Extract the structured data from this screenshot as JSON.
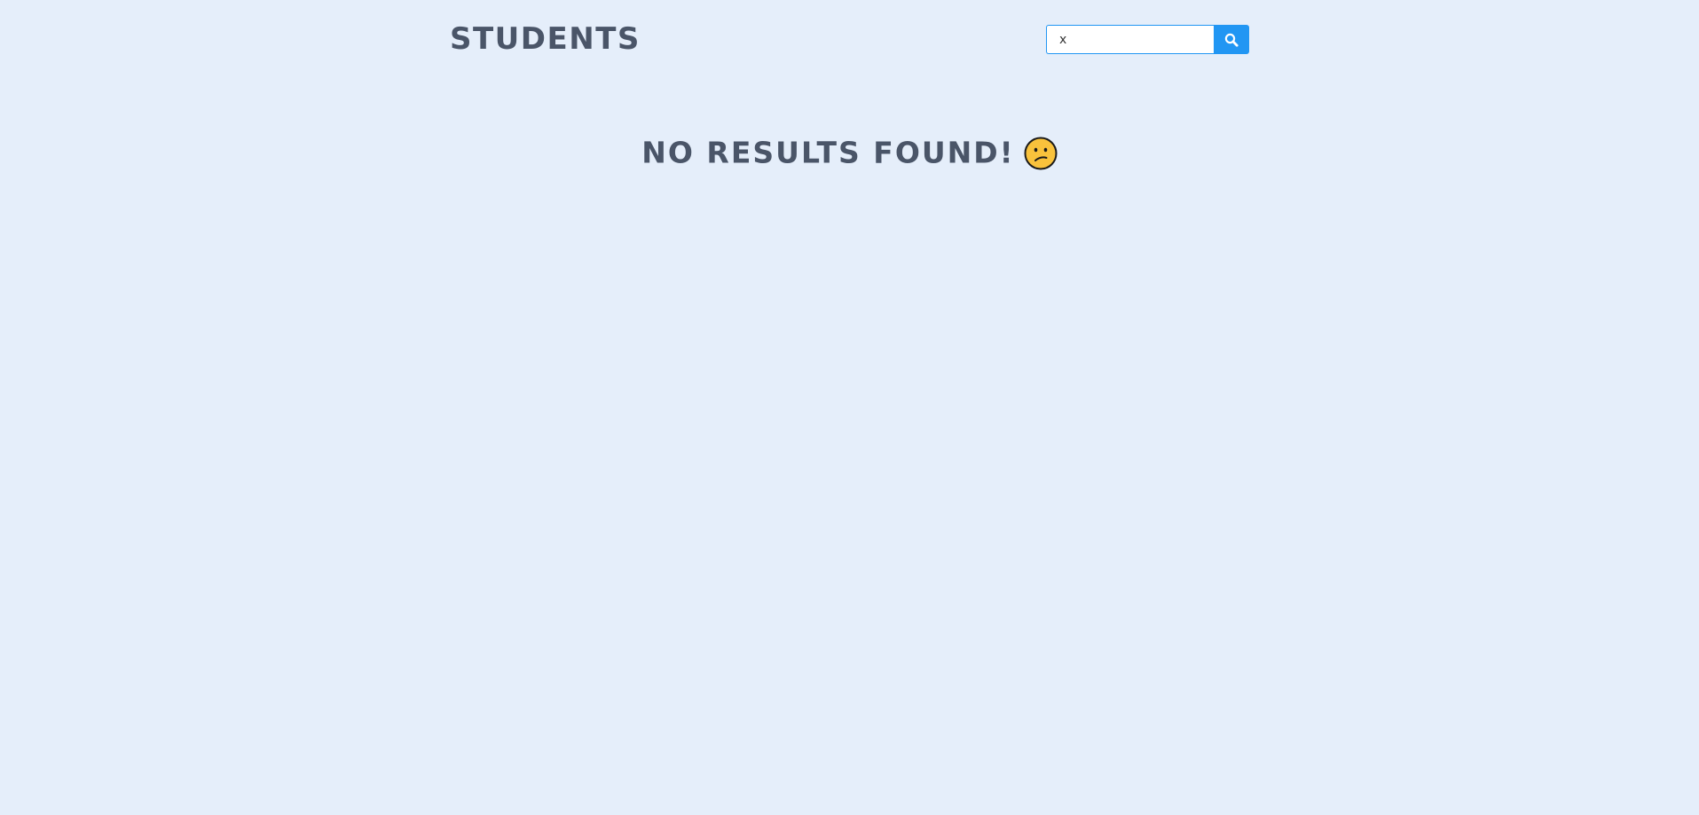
{
  "header": {
    "title": "STUDENTS"
  },
  "search": {
    "value": "x",
    "button_icon": "search-icon",
    "accent_color": "#2196f3"
  },
  "results": {
    "message": "NO RESULTS FOUND!",
    "icon": "confused-face-emoji"
  },
  "colors": {
    "background": "#e5eefa",
    "text": "#4a5568"
  }
}
